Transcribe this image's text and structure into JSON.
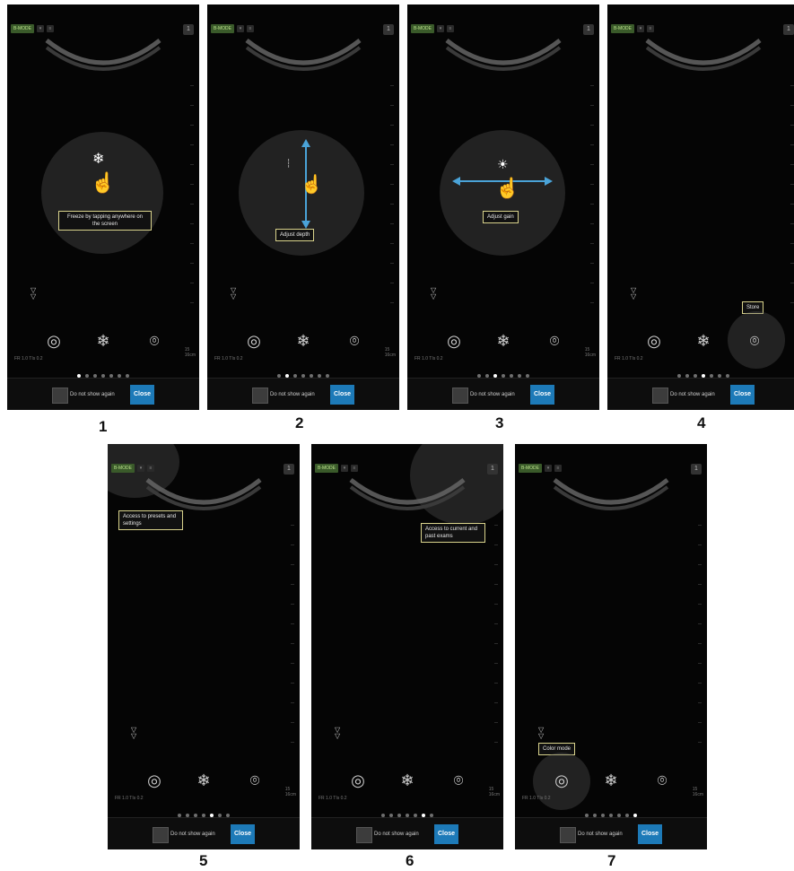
{
  "common": {
    "mode_badge": "B-MODE",
    "user_icon": "1",
    "status_left": "FR 1.0   TIs 0.2",
    "status_right_top": "15",
    "status_right": "16cm",
    "checkbox_label": "Do not show again",
    "close_label": "Close"
  },
  "icons": {
    "gesture": "hand-pointer-icon",
    "freeze": "snowflake-icon",
    "store": "camera-icon",
    "exam": "probe-icon",
    "gain": "sun-icon",
    "depth": "ruler-icon",
    "chevrons": "double-chevron-down-icon"
  },
  "screens": [
    {
      "step": "1",
      "hint": "Freeze by tapping anywhere on the screen",
      "active_dot": 0
    },
    {
      "step": "2",
      "hint": "Adjust depth",
      "active_dot": 1
    },
    {
      "step": "3",
      "hint": "Adjust gain",
      "active_dot": 2
    },
    {
      "step": "4",
      "hint": "Store",
      "active_dot": 3
    },
    {
      "step": "5",
      "hint": "Access to presets and settings",
      "active_dot": 4
    },
    {
      "step": "6",
      "hint": "Access to current and past exams",
      "active_dot": 5
    },
    {
      "step": "7",
      "hint": "Color mode",
      "active_dot": 6
    }
  ],
  "colors": {
    "accent_blue": "#1d7ab8",
    "hint_border": "#d9d38c",
    "gesture_arrow": "#4aa3d8",
    "badge_green": "#3a5a2a"
  }
}
